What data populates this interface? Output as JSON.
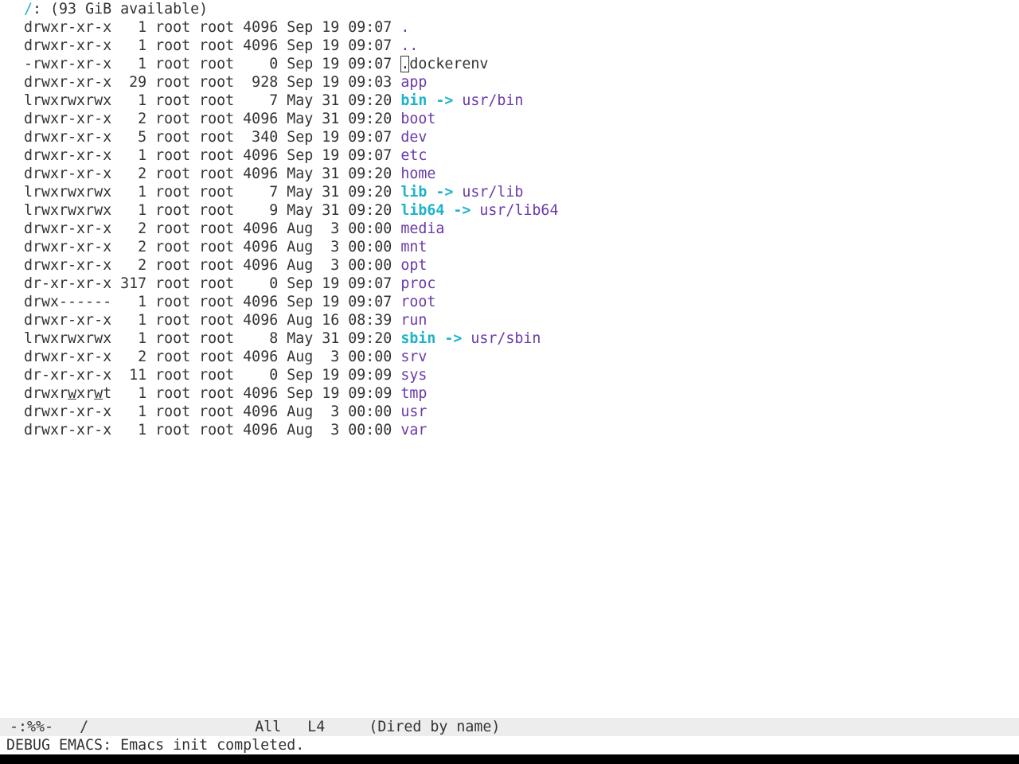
{
  "buffer": {
    "header": {
      "dir": "/",
      "rest": ": (93 GiB available)"
    },
    "entries": [
      {
        "perms": "drwxr-xr-x",
        "links": "1",
        "owner": "root",
        "group": "root",
        "size": "4096",
        "month": "Sep",
        "day": "19",
        "time": "09:07",
        "name": ".",
        "kind": "dir-dot"
      },
      {
        "perms": "drwxr-xr-x",
        "links": "1",
        "owner": "root",
        "group": "root",
        "size": "4096",
        "month": "Sep",
        "day": "19",
        "time": "09:07",
        "name": "..",
        "kind": "dir-dot"
      },
      {
        "perms": "-rwxr-xr-x",
        "links": "1",
        "owner": "root",
        "group": "root",
        "size": "0",
        "month": "Sep",
        "day": "19",
        "time": "09:07",
        "name": ".dockerenv",
        "kind": "file"
      },
      {
        "perms": "drwxr-xr-x",
        "links": "29",
        "owner": "root",
        "group": "root",
        "size": "928",
        "month": "Sep",
        "day": "19",
        "time": "09:03",
        "name": "app",
        "kind": "dir"
      },
      {
        "perms": "lrwxrwxrwx",
        "links": "1",
        "owner": "root",
        "group": "root",
        "size": "7",
        "month": "May",
        "day": "31",
        "time": "09:20",
        "name": "bin",
        "kind": "link",
        "target": "usr/bin"
      },
      {
        "perms": "drwxr-xr-x",
        "links": "2",
        "owner": "root",
        "group": "root",
        "size": "4096",
        "month": "May",
        "day": "31",
        "time": "09:20",
        "name": "boot",
        "kind": "dir"
      },
      {
        "perms": "drwxr-xr-x",
        "links": "5",
        "owner": "root",
        "group": "root",
        "size": "340",
        "month": "Sep",
        "day": "19",
        "time": "09:07",
        "name": "dev",
        "kind": "dir"
      },
      {
        "perms": "drwxr-xr-x",
        "links": "1",
        "owner": "root",
        "group": "root",
        "size": "4096",
        "month": "Sep",
        "day": "19",
        "time": "09:07",
        "name": "etc",
        "kind": "dir"
      },
      {
        "perms": "drwxr-xr-x",
        "links": "2",
        "owner": "root",
        "group": "root",
        "size": "4096",
        "month": "May",
        "day": "31",
        "time": "09:20",
        "name": "home",
        "kind": "dir"
      },
      {
        "perms": "lrwxrwxrwx",
        "links": "1",
        "owner": "root",
        "group": "root",
        "size": "7",
        "month": "May",
        "day": "31",
        "time": "09:20",
        "name": "lib",
        "kind": "link",
        "target": "usr/lib"
      },
      {
        "perms": "lrwxrwxrwx",
        "links": "1",
        "owner": "root",
        "group": "root",
        "size": "9",
        "month": "May",
        "day": "31",
        "time": "09:20",
        "name": "lib64",
        "kind": "link",
        "target": "usr/lib64"
      },
      {
        "perms": "drwxr-xr-x",
        "links": "2",
        "owner": "root",
        "group": "root",
        "size": "4096",
        "month": "Aug",
        "day": "3",
        "time": "00:00",
        "name": "media",
        "kind": "dir"
      },
      {
        "perms": "drwxr-xr-x",
        "links": "2",
        "owner": "root",
        "group": "root",
        "size": "4096",
        "month": "Aug",
        "day": "3",
        "time": "00:00",
        "name": "mnt",
        "kind": "dir"
      },
      {
        "perms": "drwxr-xr-x",
        "links": "2",
        "owner": "root",
        "group": "root",
        "size": "4096",
        "month": "Aug",
        "day": "3",
        "time": "00:00",
        "name": "opt",
        "kind": "dir"
      },
      {
        "perms": "dr-xr-xr-x",
        "links": "317",
        "owner": "root",
        "group": "root",
        "size": "0",
        "month": "Sep",
        "day": "19",
        "time": "09:07",
        "name": "proc",
        "kind": "dir"
      },
      {
        "perms": "drwx------",
        "links": "1",
        "owner": "root",
        "group": "root",
        "size": "4096",
        "month": "Sep",
        "day": "19",
        "time": "09:07",
        "name": "root",
        "kind": "dir"
      },
      {
        "perms": "drwxr-xr-x",
        "links": "1",
        "owner": "root",
        "group": "root",
        "size": "4096",
        "month": "Aug",
        "day": "16",
        "time": "08:39",
        "name": "run",
        "kind": "dir"
      },
      {
        "perms": "lrwxrwxrwx",
        "links": "1",
        "owner": "root",
        "group": "root",
        "size": "8",
        "month": "May",
        "day": "31",
        "time": "09:20",
        "name": "sbin",
        "kind": "link",
        "target": "usr/sbin"
      },
      {
        "perms": "drwxr-xr-x",
        "links": "2",
        "owner": "root",
        "group": "root",
        "size": "4096",
        "month": "Aug",
        "day": "3",
        "time": "00:00",
        "name": "srv",
        "kind": "dir"
      },
      {
        "perms": "dr-xr-xr-x",
        "links": "11",
        "owner": "root",
        "group": "root",
        "size": "0",
        "month": "Sep",
        "day": "19",
        "time": "09:09",
        "name": "sys",
        "kind": "dir"
      },
      {
        "perms": "drwxrwxrwt",
        "links": "1",
        "owner": "root",
        "group": "root",
        "size": "4096",
        "month": "Sep",
        "day": "19",
        "time": "09:09",
        "name": "tmp",
        "kind": "dir",
        "underline_w": true
      },
      {
        "perms": "drwxr-xr-x",
        "links": "1",
        "owner": "root",
        "group": "root",
        "size": "4096",
        "month": "Aug",
        "day": "3",
        "time": "00:00",
        "name": "usr",
        "kind": "dir"
      },
      {
        "perms": "drwxr-xr-x",
        "links": "1",
        "owner": "root",
        "group": "root",
        "size": "4096",
        "month": "Aug",
        "day": "3",
        "time": "00:00",
        "name": "var",
        "kind": "dir"
      }
    ],
    "link_arrow": "->"
  },
  "modeline": {
    "status": "-:%%-",
    "buffer_name": "/",
    "position": "All",
    "line": "L4",
    "mode": "(Dired by name)"
  },
  "echo_area": {
    "message": "DEBUG EMACS: Emacs init completed."
  },
  "colors": {
    "directory": "#6a3aa8",
    "symlink": "#1fb3c9",
    "text": "#333333",
    "modeline_bg": "#ededed"
  }
}
